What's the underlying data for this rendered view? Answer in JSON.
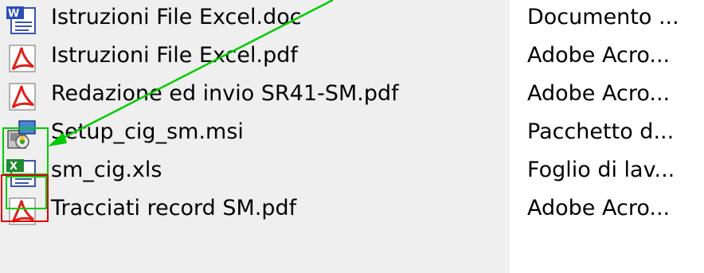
{
  "files": [
    {
      "name": "Istruzioni File Excel.doc",
      "type": "Documento ...",
      "icon": "word-document-icon"
    },
    {
      "name": "Istruzioni File Excel.pdf",
      "type": "Adobe Acro...",
      "icon": "pdf-icon"
    },
    {
      "name": "Redazione ed invio SR41-SM.pdf",
      "type": "Adobe Acro...",
      "icon": "pdf-icon"
    },
    {
      "name": "Setup_cig_sm.msi",
      "type": "Pacchetto d...",
      "icon": "installer-package-icon"
    },
    {
      "name": "sm_cig.xls",
      "type": "Foglio di lav...",
      "icon": "excel-spreadsheet-icon"
    },
    {
      "name": "Tracciati record SM.pdf",
      "type": "Adobe Acro...",
      "icon": "pdf-icon"
    }
  ],
  "colors": {
    "name_column_bg": "#efefef",
    "annotation_green": "#00cc00",
    "annotation_red": "#e00000"
  }
}
